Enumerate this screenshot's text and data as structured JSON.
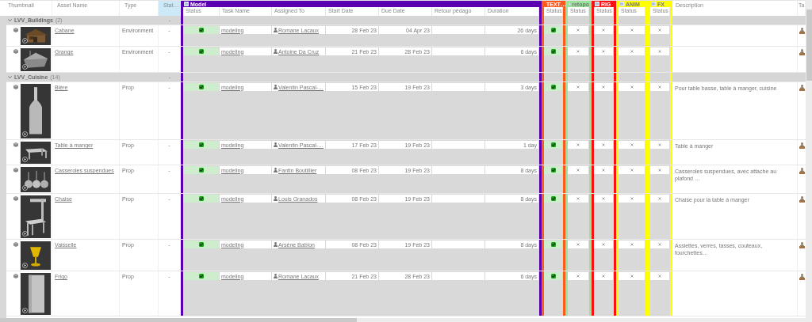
{
  "columns": [
    {
      "label": "Thumbnail",
      "selected": false
    },
    {
      "label": "Asset Name",
      "selected": false
    },
    {
      "label": "Type",
      "selected": false
    },
    {
      "label": "Stat…",
      "selected": true
    }
  ],
  "steps": [
    {
      "name": "Model",
      "color": "#5a00b0",
      "columns": [
        "Status",
        "Task Name",
        "Assigned To",
        "Start Date",
        "Due Date",
        "Retour pédago",
        "Duration"
      ]
    },
    {
      "name": "TEXT…",
      "color": "#ff5a1e",
      "columns": [
        "Status"
      ]
    },
    {
      "name": "retopo",
      "color": "#9be39b",
      "columns": [
        "Status"
      ]
    },
    {
      "name": "RIG",
      "color": "#ff1010",
      "columns": [
        "Status"
      ]
    },
    {
      "name": "ANIM",
      "color": "#ffff00",
      "columns": [
        "Status"
      ]
    },
    {
      "name": "FX",
      "color": "#ffff00",
      "columns": [
        "Status"
      ]
    }
  ],
  "extra_columns": [
    {
      "label": "Description"
    },
    {
      "label": "Ta"
    }
  ],
  "groups": [
    {
      "name": "LVV_Buildings",
      "count": "(2)",
      "expanded": true,
      "status": "-",
      "assets": [
        {
          "name": "Cabane",
          "type": "Environment",
          "status": "-",
          "tasks": [
            {
              "complete": true,
              "task_name": "modeling",
              "assigned_to": "Romane Lacaux",
              "start_date": "28 Feb 23",
              "due_date": "04 Apr 23",
              "duration": "26 days"
            },
            {
              "complete": true
            },
            {
              "complete": false
            },
            {
              "complete": false
            },
            {
              "complete": false
            },
            {
              "complete": false
            }
          ]
        },
        {
          "name": "Grange",
          "type": "Environment",
          "status": "-",
          "tasks": [
            {
              "complete": true,
              "task_name": "modeling",
              "assigned_to": "Antoine Da Cruz",
              "start_date": "21 Feb 23",
              "due_date": "28 Feb 23",
              "duration": "6 days"
            },
            {
              "complete": true
            },
            {
              "complete": false
            },
            {
              "complete": false
            },
            {
              "complete": false
            },
            {
              "complete": false
            }
          ]
        }
      ]
    },
    {
      "name": "LVV_Cuisine",
      "count": "(14)",
      "expanded": true,
      "status": "-",
      "assets": [
        {
          "name": "Bière",
          "type": "Prop",
          "status": "-",
          "description": "Pour table basse, table à manger, cuisine",
          "tasks": [
            {
              "complete": true,
              "task_name": "modeling",
              "assigned_to": "Valentin Pascal-…",
              "start_date": "15 Feb 23",
              "due_date": "19 Feb 23",
              "duration": "3 days"
            },
            {
              "complete": true
            },
            {
              "complete": false
            },
            {
              "complete": false
            },
            {
              "complete": false
            },
            {
              "complete": false
            }
          ]
        },
        {
          "name": "Table à manger",
          "type": "Prop",
          "status": "-",
          "description": "Table à manger",
          "tasks": [
            {
              "complete": true,
              "task_name": "modeling",
              "assigned_to": "Valentin Pascal-…",
              "start_date": "17 Feb 23",
              "due_date": "19 Feb 23",
              "duration": "1 day"
            },
            {
              "complete": true
            },
            {
              "complete": false
            },
            {
              "complete": false
            },
            {
              "complete": false
            },
            {
              "complete": false
            }
          ]
        },
        {
          "name": "Casseroles suspendues",
          "type": "Prop",
          "status": "-",
          "description": "Casseroles suspendues, avec attache au plafond …",
          "tasks": [
            {
              "complete": true,
              "task_name": "modeling",
              "assigned_to": "Fantin Boutillier",
              "start_date": "08 Feb 23",
              "due_date": "19 Feb 23",
              "duration": "8 days"
            },
            {
              "complete": true
            },
            {
              "complete": false
            },
            {
              "complete": false
            },
            {
              "complete": false
            },
            {
              "complete": false
            }
          ]
        },
        {
          "name": "Chaise",
          "type": "Prop",
          "status": "-",
          "description": "Chaise pour la table à manger",
          "tasks": [
            {
              "complete": true,
              "task_name": "modeling",
              "assigned_to": "Louis Granados",
              "start_date": "08 Feb 23",
              "due_date": "19 Feb 23",
              "duration": "8 days"
            },
            {
              "complete": true
            },
            {
              "complete": false
            },
            {
              "complete": false
            },
            {
              "complete": false
            },
            {
              "complete": false
            }
          ]
        },
        {
          "name": "Vaisselle",
          "type": "Prop",
          "status": "-",
          "description": "Assiettes, verres, tasses, couteaux, fourchettes…",
          "tasks": [
            {
              "complete": true,
              "task_name": "modeling",
              "assigned_to": "Arsène Bablon",
              "start_date": "08 Feb 23",
              "due_date": "19 Feb 23",
              "duration": "8 days"
            },
            {
              "complete": true
            },
            {
              "complete": false
            },
            {
              "complete": false
            },
            {
              "complete": false
            },
            {
              "complete": false
            }
          ]
        },
        {
          "name": "Frigo",
          "type": "Prop",
          "status": "-",
          "tasks": [
            {
              "complete": true,
              "task_name": "modeling",
              "assigned_to": "Romane Lacaux",
              "start_date": "21 Feb 23",
              "due_date": "28 Feb 23",
              "duration": "6 days"
            },
            {
              "complete": true
            },
            {
              "complete": false
            },
            {
              "complete": false
            },
            {
              "complete": false
            },
            {
              "complete": false
            }
          ]
        }
      ]
    }
  ]
}
